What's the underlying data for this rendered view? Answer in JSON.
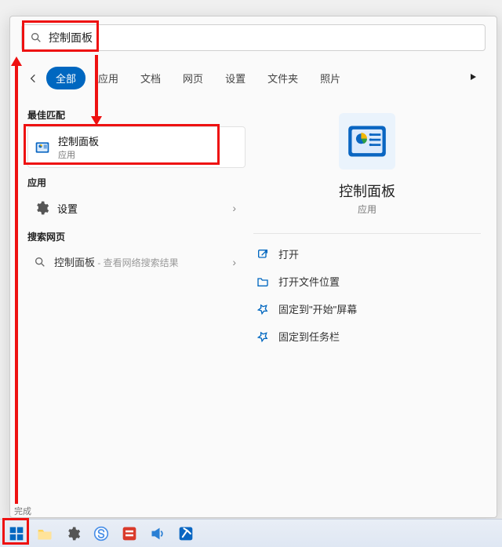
{
  "search": {
    "value": "控制面板"
  },
  "tabs": {
    "items": [
      "全部",
      "应用",
      "文档",
      "网页",
      "设置",
      "文件夹",
      "照片"
    ],
    "active_index": 0
  },
  "sections": {
    "best_match": "最佳匹配",
    "apps": "应用",
    "web": "搜索网页"
  },
  "best_match_item": {
    "title": "控制面板",
    "subtitle": "应用"
  },
  "apps_item": {
    "title": "设置"
  },
  "web_item": {
    "title": "控制面板",
    "suffix": " - 查看网络搜索结果"
  },
  "detail": {
    "title": "控制面板",
    "type": "应用",
    "actions": [
      "打开",
      "打开文件位置",
      "固定到\"开始\"屏幕",
      "固定到任务栏"
    ]
  },
  "taskbar": {
    "status": "完成"
  },
  "colors": {
    "accent": "#0067c0",
    "anno": "#e11"
  }
}
